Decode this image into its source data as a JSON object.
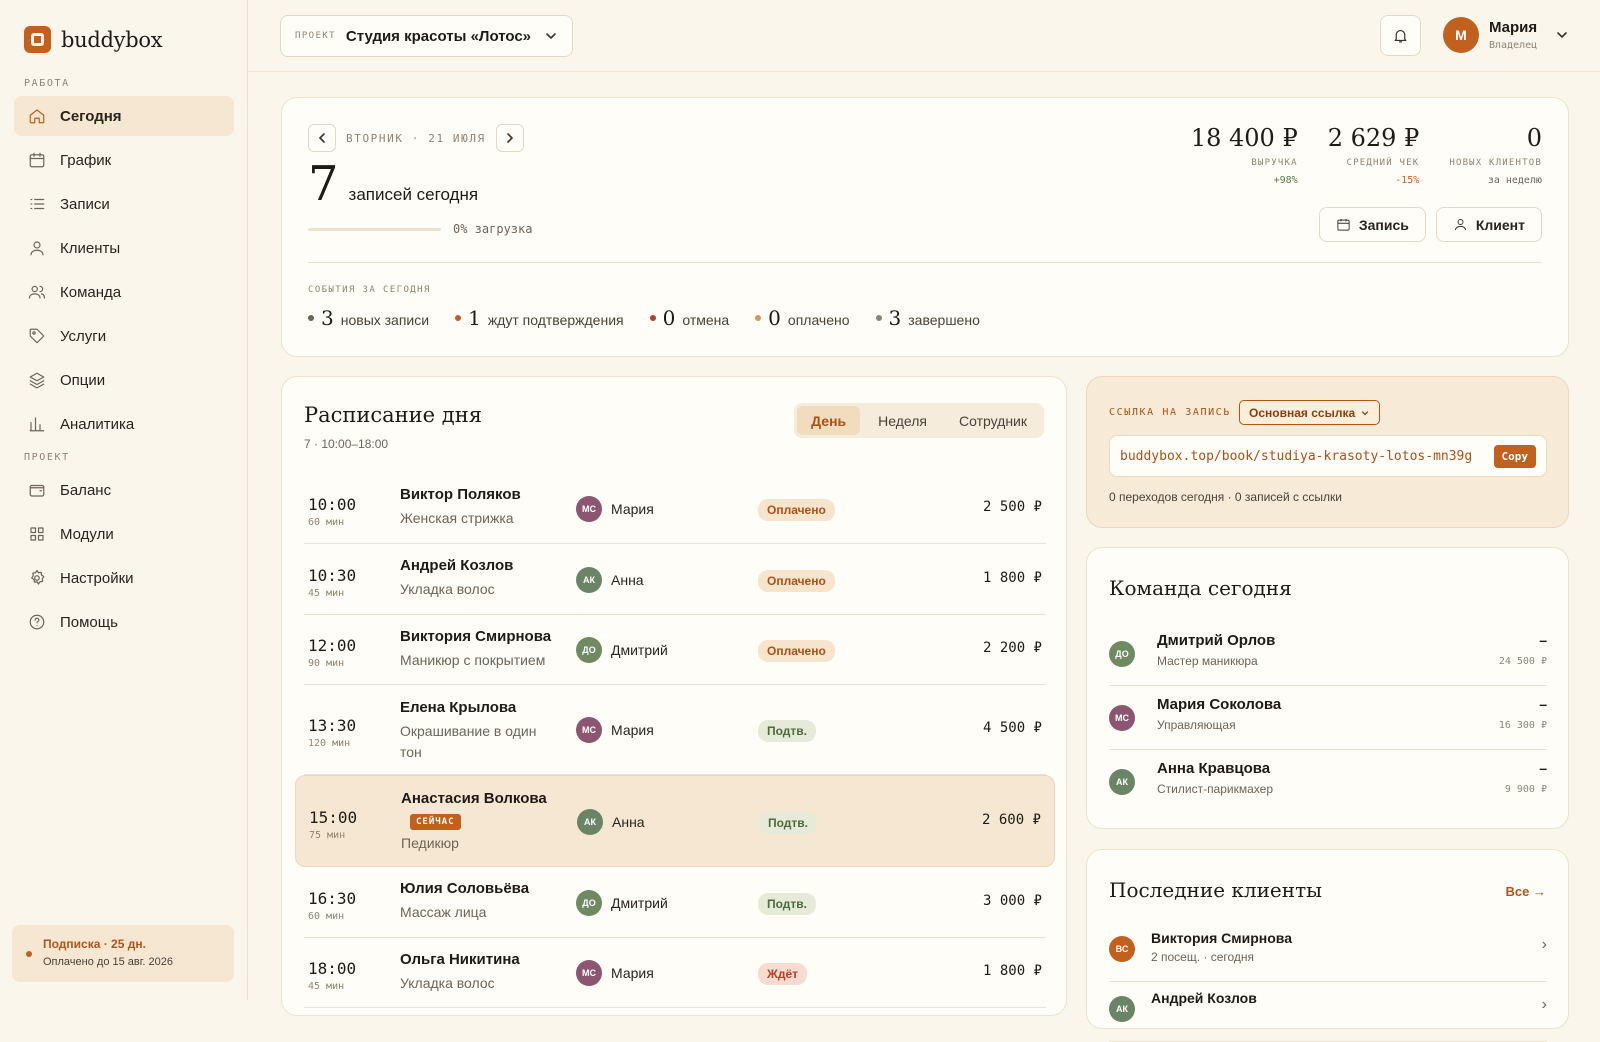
{
  "brand": {
    "name": "buddybox"
  },
  "sidebar": {
    "work_label": "РАБОТА",
    "project_label": "ПРОЕКТ",
    "work_items": [
      {
        "label": "Сегодня",
        "icon": "home-icon",
        "active": true
      },
      {
        "label": "График",
        "icon": "calendar-icon"
      },
      {
        "label": "Записи",
        "icon": "list-icon"
      },
      {
        "label": "Клиенты",
        "icon": "user-icon"
      },
      {
        "label": "Команда",
        "icon": "users-icon"
      },
      {
        "label": "Услуги",
        "icon": "tag-icon"
      },
      {
        "label": "Опции",
        "icon": "layers-icon"
      },
      {
        "label": "Аналитика",
        "icon": "chart-icon"
      }
    ],
    "project_items": [
      {
        "label": "Баланс",
        "icon": "wallet-icon"
      },
      {
        "label": "Модули",
        "icon": "grid-icon"
      },
      {
        "label": "Настройки",
        "icon": "gear-icon"
      },
      {
        "label": "Помощь",
        "icon": "help-icon"
      }
    ],
    "subscription": {
      "title": "Подписка · 25 дн.",
      "paid_until": "Оплачено до 15 авг. 2026"
    }
  },
  "topbar": {
    "project_label": "ПРОЕКТ",
    "project_name": "Студия красоты «Лотос»",
    "user": {
      "initial": "М",
      "name": "Мария",
      "role": "Владелец"
    }
  },
  "summary": {
    "date": "ВТОРНИК · 21 ИЮЛЯ",
    "count": "7",
    "count_label": "записей сегодня",
    "load": 0,
    "load_label": "0% загрузка",
    "stats": [
      {
        "value": "18 400 ₽",
        "label": "ВЫРУЧКА",
        "delta": "+98%",
        "trend": "up"
      },
      {
        "value": "2 629 ₽",
        "label": "СРЕДНИЙ ЧЕК",
        "delta": "-15%",
        "trend": "down"
      },
      {
        "value": "0",
        "label": "НОВЫХ КЛИЕНТОВ",
        "delta": "за неделю",
        "trend": "flat"
      }
    ],
    "actions": {
      "booking": "Запись",
      "client": "Клиент"
    },
    "events_label": "СОБЫТИЯ ЗА СЕГОДНЯ",
    "events": [
      {
        "n": "3",
        "label": "новых записи",
        "color": "#5f6e4a"
      },
      {
        "n": "1",
        "label": "ждут подтверждения",
        "color": "#c2601e"
      },
      {
        "n": "0",
        "label": "отмена",
        "color": "#b8402a"
      },
      {
        "n": "0",
        "label": "оплачено",
        "color": "#d19a5a"
      },
      {
        "n": "3",
        "label": "завершено",
        "color": "#8f8474"
      }
    ]
  },
  "schedule": {
    "title": "Расписание дня",
    "subtitle": "7 · 10:00–18:00",
    "tabs": [
      "День",
      "Неделя",
      "Сотрудник"
    ],
    "now_label": "СЕЙЧАС",
    "rows": [
      {
        "time": "10:00",
        "dur": "60 мин",
        "client": "Виктор Поляков",
        "service": "Женская стрижка",
        "staff_initials": "МС",
        "staff": "Мария",
        "staff_color": "#8c5670",
        "status": "Оплачено",
        "status_kind": "paid",
        "price": "2 500 ₽"
      },
      {
        "time": "10:30",
        "dur": "45 мин",
        "client": "Андрей Козлов",
        "service": "Укладка волос",
        "staff_initials": "АК",
        "staff": "Анна",
        "staff_color": "#6a8466",
        "status": "Оплачено",
        "status_kind": "paid",
        "price": "1 800 ₽"
      },
      {
        "time": "12:00",
        "dur": "90 мин",
        "client": "Виктория Смирнова",
        "service": "Маникюр с покрытием",
        "staff_initials": "ДО",
        "staff": "Дмитрий",
        "staff_color": "#6f8a62",
        "status": "Оплачено",
        "status_kind": "paid",
        "price": "2 200 ₽"
      },
      {
        "time": "13:30",
        "dur": "120 мин",
        "client": "Елена Крылова",
        "service": "Окрашивание в один тон",
        "staff_initials": "МС",
        "staff": "Мария",
        "staff_color": "#8c5670",
        "status": "Подтв.",
        "status_kind": "conf",
        "price": "4 500 ₽"
      },
      {
        "time": "15:00",
        "dur": "75 мин",
        "client": "Анастасия Волкова",
        "service": "Педикюр",
        "staff_initials": "АК",
        "staff": "Анна",
        "staff_color": "#6a8466",
        "status": "Подтв.",
        "status_kind": "conf",
        "price": "2 600 ₽",
        "now": true
      },
      {
        "time": "16:30",
        "dur": "60 мин",
        "client": "Юлия Соловьёва",
        "service": "Массаж лица",
        "staff_initials": "ДО",
        "staff": "Дмитрий",
        "staff_color": "#6f8a62",
        "status": "Подтв.",
        "status_kind": "conf",
        "price": "3 000 ₽"
      },
      {
        "time": "18:00",
        "dur": "45 мин",
        "client": "Ольга Никитина",
        "service": "Укладка волос",
        "staff_initials": "МС",
        "staff": "Мария",
        "staff_color": "#8c5670",
        "status": "Ждёт",
        "status_kind": "wait",
        "price": "1 800 ₽"
      }
    ]
  },
  "booking_link": {
    "label": "ССЫЛКА НА ЗАПИСЬ",
    "selector": "Основная ссылка",
    "url": "buddybox.top/book/studiya-krasoty-lotos-mn39g",
    "copy": "Copy",
    "stats": "0 переходов сегодня · 0 записей с ссылки"
  },
  "team": {
    "title": "Команда сегодня",
    "members": [
      {
        "initials": "ДО",
        "name": "Дмитрий Орлов",
        "role": "Мастер маникюра",
        "dash": "–",
        "amount": "24 500 ₽",
        "color": "#6f8a62"
      },
      {
        "initials": "МС",
        "name": "Мария Соколова",
        "role": "Управляющая",
        "dash": "–",
        "amount": "16 300 ₽",
        "color": "#8c5670"
      },
      {
        "initials": "АК",
        "name": "Анна Кравцова",
        "role": "Стилист-парикмахер",
        "dash": "–",
        "amount": "9 900 ₽",
        "color": "#6a8466"
      }
    ]
  },
  "recent": {
    "title": "Последние клиенты",
    "all": "Все →",
    "clients": [
      {
        "initials": "ВС",
        "name": "Виктория Смирнова",
        "meta": "2 посещ. · сегодня",
        "color": "#c2601e"
      },
      {
        "initials": "АК",
        "name": "Андрей Козлов",
        "meta": "",
        "color": "#6a8466"
      }
    ]
  }
}
